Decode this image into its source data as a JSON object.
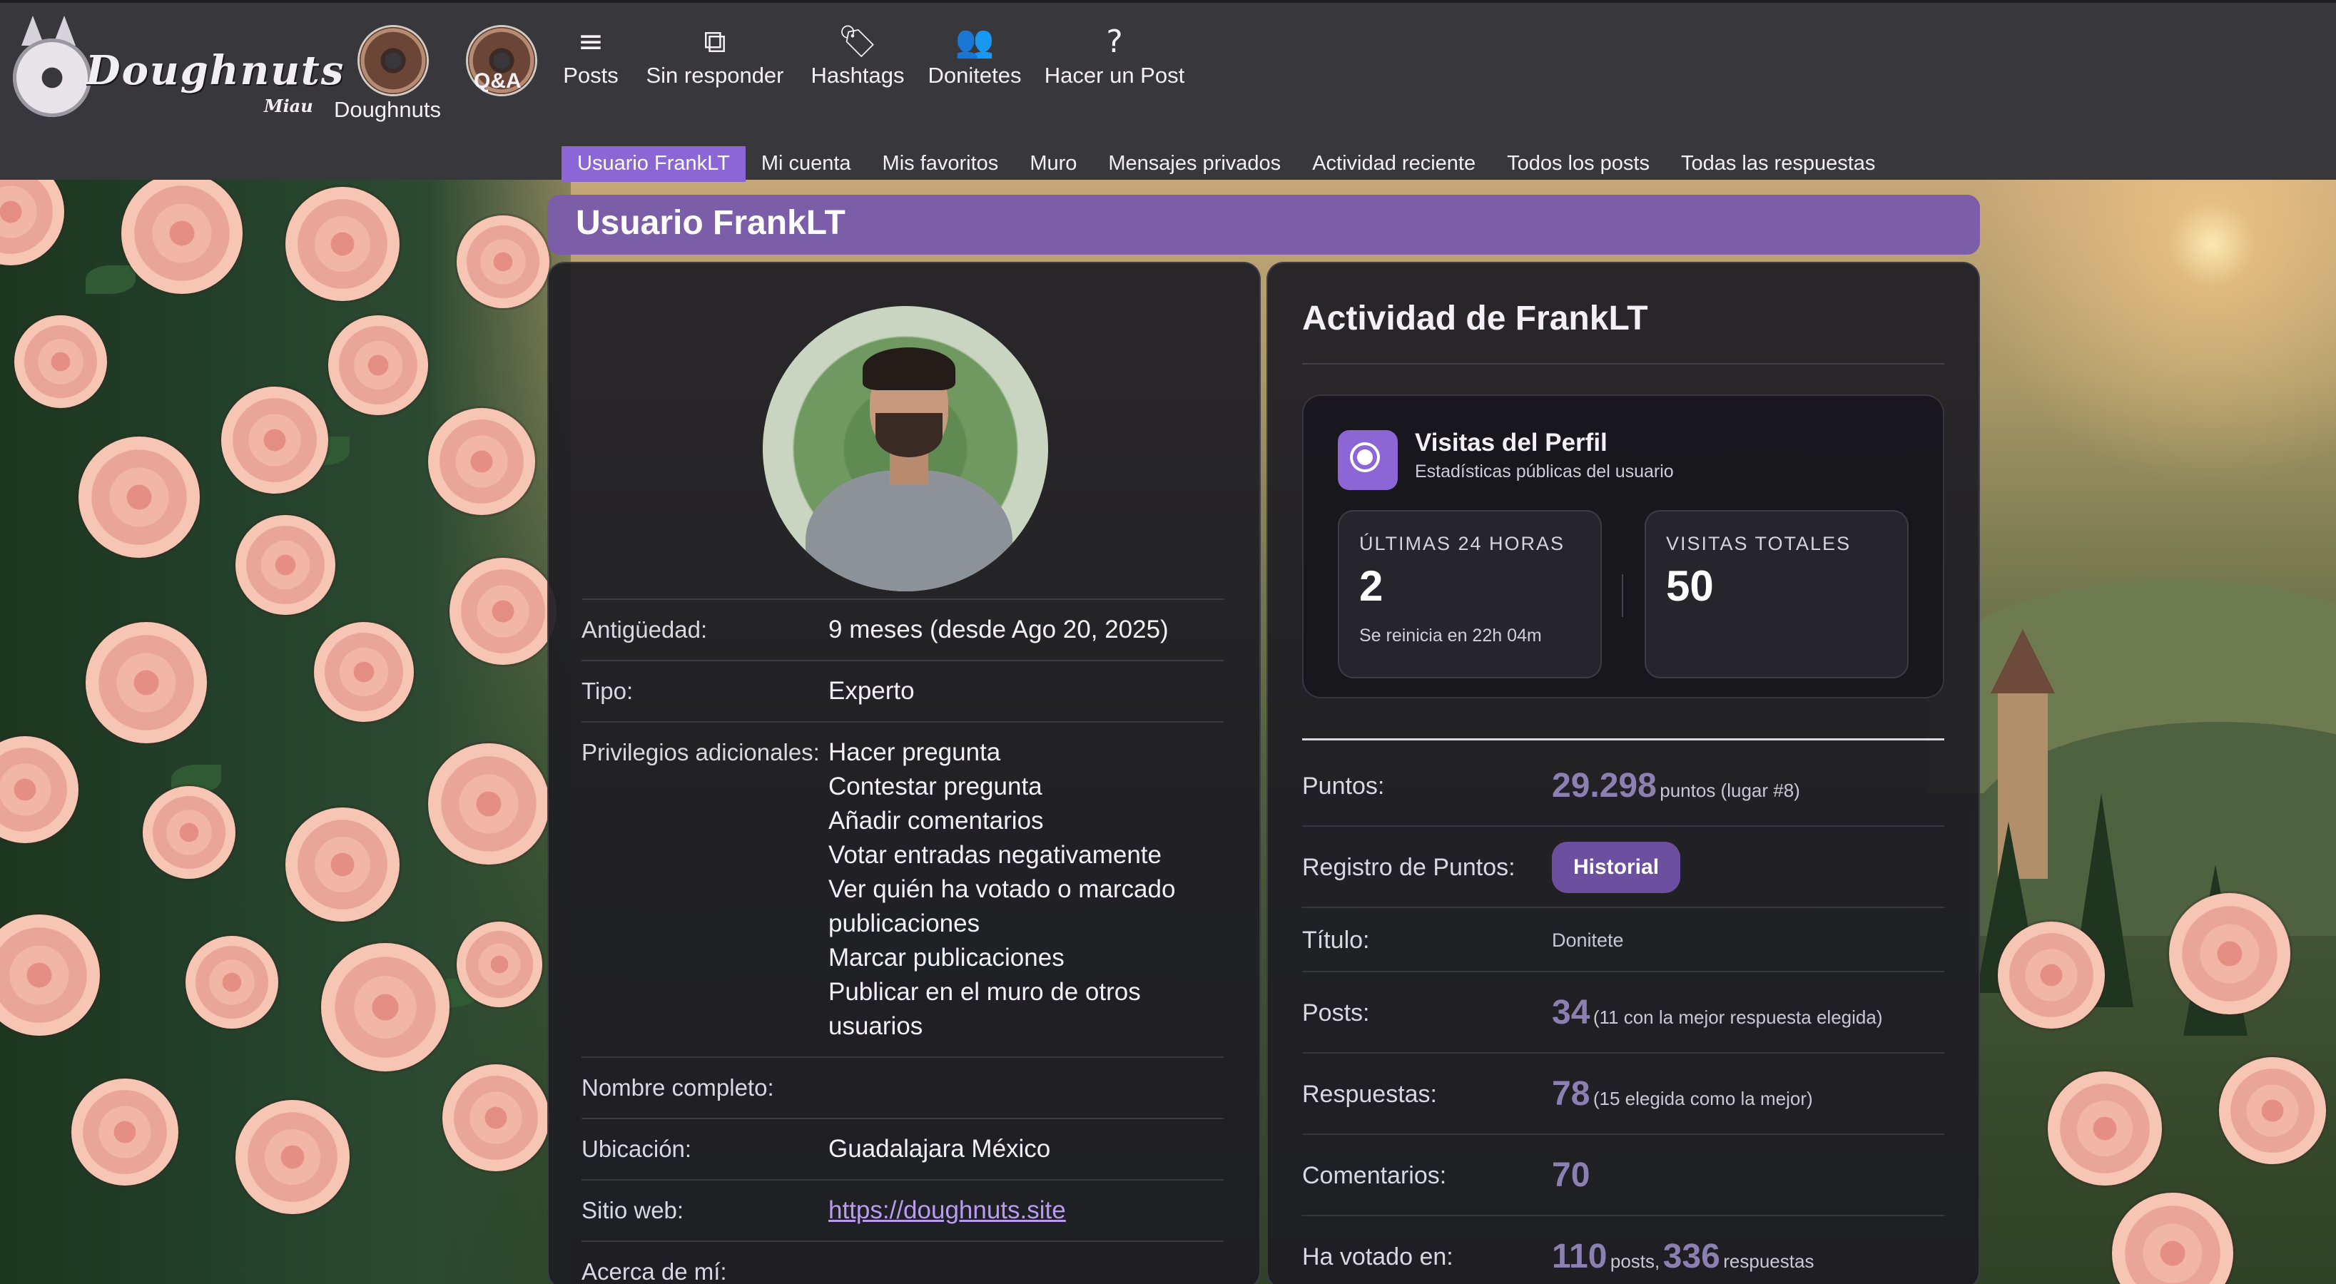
{
  "logo": {
    "text": "Doughnuts",
    "sub": "Miau"
  },
  "header": {
    "doughnuts_label": "Doughnuts",
    "qa_label": "Q&A"
  },
  "topnav": [
    {
      "label": "Posts",
      "icon": "list-icon"
    },
    {
      "label": "Sin responder",
      "icon": "unanswered-icon"
    },
    {
      "label": "Hashtags",
      "icon": "tag-icon"
    },
    {
      "label": "Donitetes",
      "icon": "users-icon"
    },
    {
      "label": "Hacer un Post",
      "icon": "question-icon"
    }
  ],
  "subnav": [
    {
      "label": "Usuario FrankLT",
      "active": true
    },
    {
      "label": "Mi cuenta"
    },
    {
      "label": "Mis favoritos"
    },
    {
      "label": "Muro"
    },
    {
      "label": "Mensajes privados"
    },
    {
      "label": "Actividad reciente"
    },
    {
      "label": "Todos los posts"
    },
    {
      "label": "Todas las respuestas"
    }
  ],
  "page_title": "Usuario FrankLT",
  "profile": {
    "rows": [
      {
        "key": "Antigüedad:",
        "value": "9 meses (desde Ago 20, 2025)"
      },
      {
        "key": "Tipo:",
        "value": "Experto"
      },
      {
        "key": "Privilegios adicionales:",
        "values": [
          "Hacer pregunta",
          "Contestar pregunta",
          "Añadir comentarios",
          "Votar entradas negativamente",
          "Ver quién ha votado o marcado publicaciones",
          "Marcar publicaciones",
          "Publicar en el muro de otros usuarios"
        ]
      },
      {
        "key": "Nombre completo:",
        "value": ""
      },
      {
        "key": "Ubicación:",
        "value": "Guadalajara México"
      },
      {
        "key": "Sitio web:",
        "value": "https://doughnuts.site"
      },
      {
        "key": "Acerca de mí:",
        "value": ""
      }
    ]
  },
  "activity": {
    "title": "Actividad de FrankLT",
    "visits": {
      "title": "Visitas del Perfil",
      "subtitle": "Estadísticas públicas del usuario",
      "last24_caption": "ÚLTIMAS 24 HORAS",
      "last24_value": "2",
      "last24_note": "Se reinicia en 22h 04m",
      "total_caption": "VISITAS TOTALES",
      "total_value": "50"
    },
    "rows": {
      "puntos_key": "Puntos:",
      "puntos_value": "29.298",
      "puntos_note": "puntos (lugar #8)",
      "registro_key": "Registro de Puntos:",
      "registro_button": "Historial",
      "titulo_key": "Título:",
      "titulo_value": "Donitete",
      "posts_key": "Posts:",
      "posts_value": "34",
      "posts_note": "(11 con la mejor respuesta elegida)",
      "respuestas_key": "Respuestas:",
      "respuestas_value": "78",
      "respuestas_note": "(15 elegida como la mejor)",
      "comentarios_key": "Comentarios:",
      "comentarios_value": "70",
      "votado_key": "Ha votado en:",
      "votado_posts_value": "110",
      "votado_posts_note": "posts,",
      "votado_resp_value": "336",
      "votado_resp_note": "respuestas"
    }
  },
  "colors": {
    "accent": "#8d66d6",
    "title_bar": "#7b5ea7",
    "button": "#6d4fa0",
    "link": "#b99bf2"
  }
}
